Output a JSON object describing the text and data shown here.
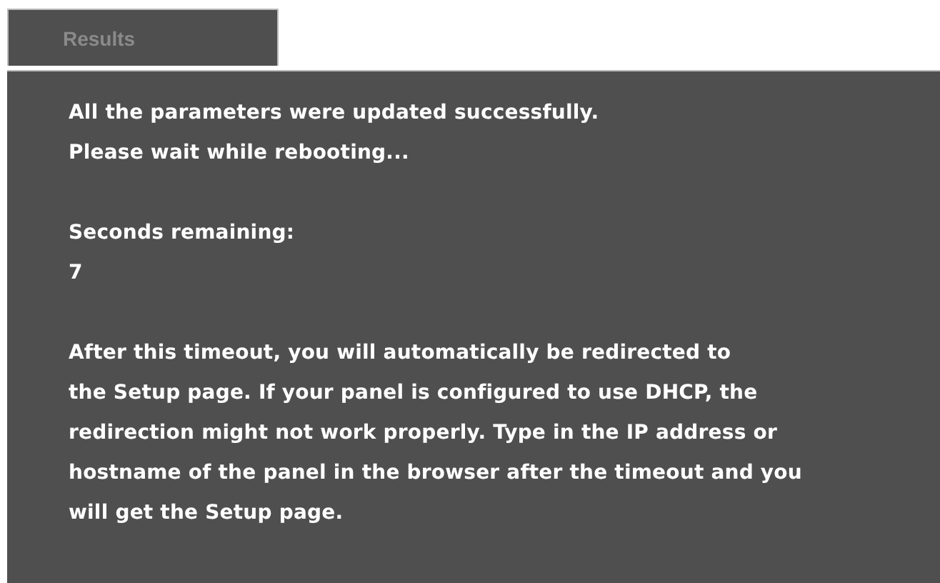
{
  "tabs": [
    {
      "label": "Results",
      "selected": false
    }
  ],
  "paragraphs": [
    {
      "lines": [
        "All the parameters were updated successfully.",
        "Please wait while rebooting..."
      ]
    },
    {
      "lines": [
        "Seconds remaining:",
        "7"
      ]
    },
    {
      "lines": [
        "After this timeout, you will automatically be redirected to",
        "the Setup page. If your panel is configured to use DHCP, the",
        "redirection might not work properly. Type in the IP address or",
        "hostname of the panel in the browser after the timeout and you",
        "will get the Setup page."
      ]
    }
  ]
}
